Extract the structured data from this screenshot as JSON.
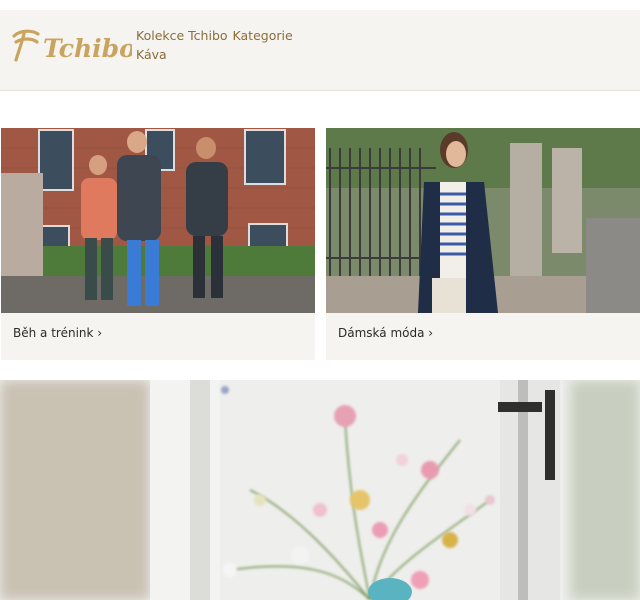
{
  "brand": {
    "logo_text": "Tchibo",
    "color": "#c9a45f"
  },
  "nav": {
    "items": [
      {
        "label": "Kolekce Tchibo"
      },
      {
        "label": "Kategorie"
      },
      {
        "label": "Káva"
      }
    ]
  },
  "promos": [
    {
      "label": "Běh a trénink ›"
    },
    {
      "label": "Dámská móda ›"
    }
  ],
  "colors": {
    "header_bg": "#f6f4f0",
    "nav_text": "#8a6d3b",
    "card_bg": "#f6f4f0"
  }
}
